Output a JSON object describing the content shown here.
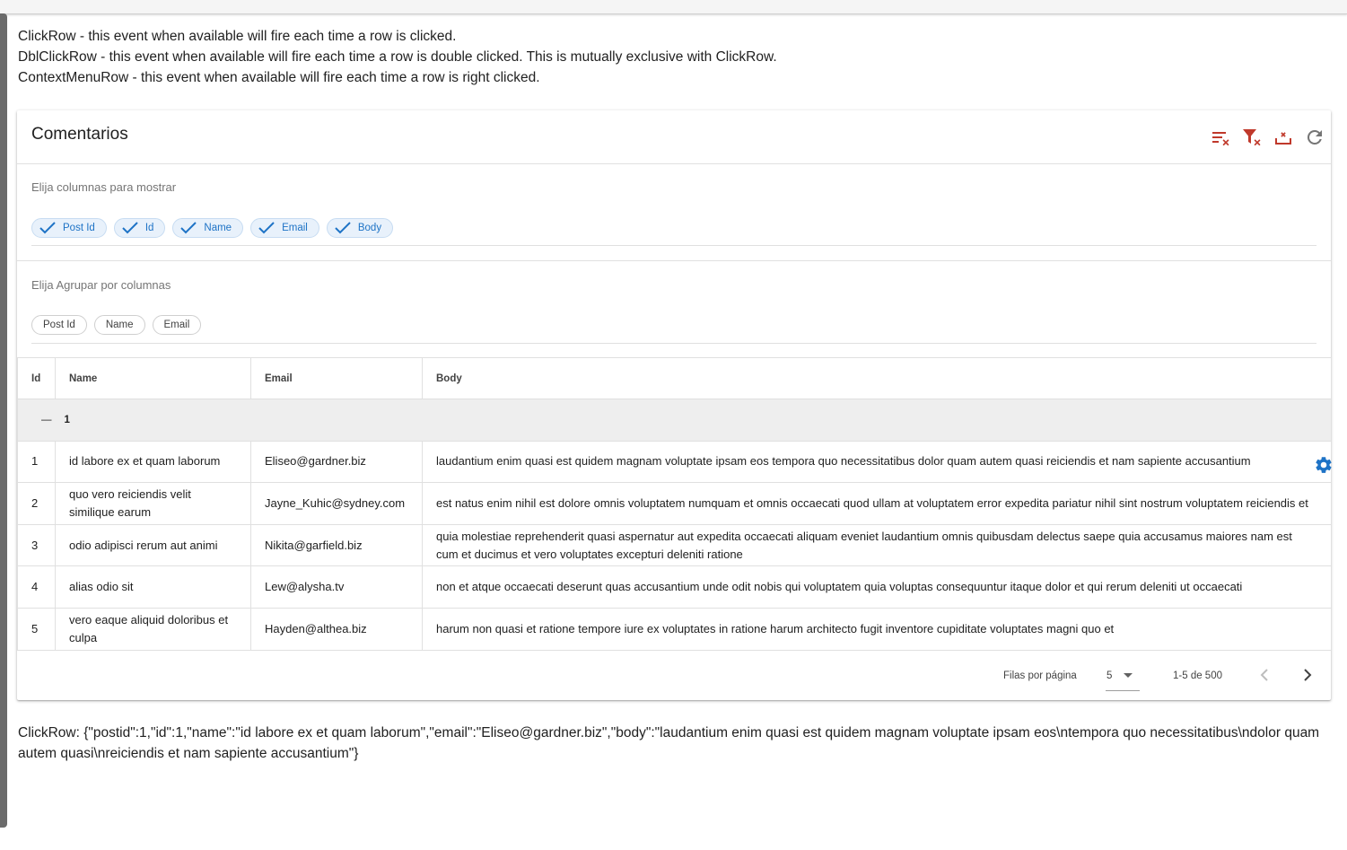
{
  "intro": {
    "line1": "ClickRow - this event when available will fire each time a row is clicked.",
    "line2": "DblClickRow - this event when available will fire each time a row is double clicked. This is mutually exclusive with ClickRow.",
    "line3": "ContextMenuRow - this event when available will fire each time a row is right clicked."
  },
  "card": {
    "title": "Comentarios",
    "toolbar_icons": [
      "clear-sort-icon",
      "clear-filter-icon",
      "export-icon",
      "refresh-icon"
    ],
    "accent_color": "#c0392b"
  },
  "columns_section": {
    "label": "Elija columnas para mostrar",
    "chips": [
      "Post Id",
      "Id",
      "Name",
      "Email",
      "Body"
    ]
  },
  "group_section": {
    "label": "Elija Agrupar por columnas",
    "chips": [
      "Post Id",
      "Name",
      "Email"
    ]
  },
  "table": {
    "headers": [
      "Id",
      "Name",
      "Email",
      "Body"
    ],
    "group_symbol": "—",
    "group_value": "1",
    "rows": [
      {
        "id": "1",
        "name": "id labore ex et quam laborum",
        "email": "Eliseo@gardner.biz",
        "body": "laudantium enim quasi est quidem magnam voluptate ipsam eos tempora quo necessitatibus dolor quam autem quasi reiciendis et nam sapiente accusantium"
      },
      {
        "id": "2",
        "name": "quo vero reiciendis velit similique earum",
        "email": "Jayne_Kuhic@sydney.com",
        "body": "est natus enim nihil est dolore omnis voluptatem numquam et omnis occaecati quod ullam at voluptatem error expedita pariatur nihil sint nostrum voluptatem reiciendis et"
      },
      {
        "id": "3",
        "name": "odio adipisci rerum aut animi",
        "email": "Nikita@garfield.biz",
        "body": "quia molestiae reprehenderit quasi aspernatur aut expedita occaecati aliquam eveniet laudantium omnis quibusdam delectus saepe quia accusamus maiores nam est cum et ducimus et vero voluptates excepturi deleniti ratione"
      },
      {
        "id": "4",
        "name": "alias odio sit",
        "email": "Lew@alysha.tv",
        "body": "non et atque occaecati deserunt quas accusantium unde odit nobis qui voluptatem quia voluptas consequuntur itaque dolor et qui rerum deleniti ut occaecati"
      },
      {
        "id": "5",
        "name": "vero eaque aliquid doloribus et culpa",
        "email": "Hayden@althea.biz",
        "body": "harum non quasi et ratione tempore iure ex voluptates in ratione harum architecto fugit inventore cupiditate voluptates magni quo et"
      }
    ]
  },
  "pagination": {
    "rows_per_page_label": "Filas por página",
    "rows_per_page_value": "5",
    "range_text": "1-5 de 500"
  },
  "output_text": "ClickRow: {\"postid\":1,\"id\":1,\"name\":\"id labore ex et quam laborum\",\"email\":\"Eliseo@gardner.biz\",\"body\":\"laudantium enim quasi est quidem magnam voluptate ipsam eos\\ntempora quo necessitatibus\\ndolor quam autem quasi\\nreiciendis et nam sapiente accusantium\"}"
}
